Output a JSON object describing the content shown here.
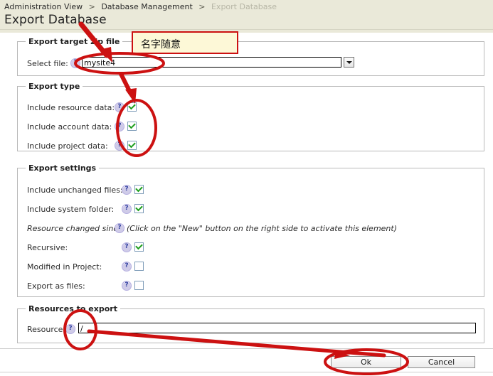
{
  "header": {
    "breadcrumb": [
      {
        "label": "Administration View",
        "current": false
      },
      {
        "label": "Database Management",
        "current": false
      },
      {
        "label": "Export Database",
        "current": true
      }
    ],
    "separator": ">",
    "title": "Export Database",
    "background_color": "#eae9d9"
  },
  "sections": {
    "target": {
      "legend": "Export target zip file",
      "file_label": "Select file:",
      "file_value": "mysite4",
      "file_placeholder": "",
      "dropdown_icon": "chevron-down-icon",
      "help_icon": "help-icon"
    },
    "export_type": {
      "legend": "Export type",
      "rows": [
        {
          "label": "Include resource data:",
          "checked": true
        },
        {
          "label": "Include account data:",
          "checked": true
        },
        {
          "label": "Include project data:",
          "checked": true
        }
      ]
    },
    "export_settings": {
      "legend": "Export settings",
      "rows": [
        {
          "label": "Include unchanged files:",
          "checked": true
        },
        {
          "label": "Include system folder:",
          "checked": true
        }
      ],
      "changed_since_label": "Resource changed since:",
      "changed_since_hint": "(Click on the \"New\" button on the right side to activate this element)",
      "rows2": [
        {
          "label": "Recursive:",
          "checked": true
        },
        {
          "label": "Modified in Project:",
          "checked": false
        },
        {
          "label": "Export as files:",
          "checked": false
        }
      ]
    },
    "resources": {
      "legend": "Resources to export",
      "resource_label": "Resource:",
      "resource_value": "/",
      "help_icon": "help-icon"
    }
  },
  "footer": {
    "ok_label": "Ok",
    "cancel_label": "Cancel"
  },
  "annotations": {
    "note_text": "名字随意",
    "note_fill": "#fdf8d7",
    "note_border": "#cc1111",
    "marker_color": "#cc1111"
  },
  "help_glyph": "?"
}
